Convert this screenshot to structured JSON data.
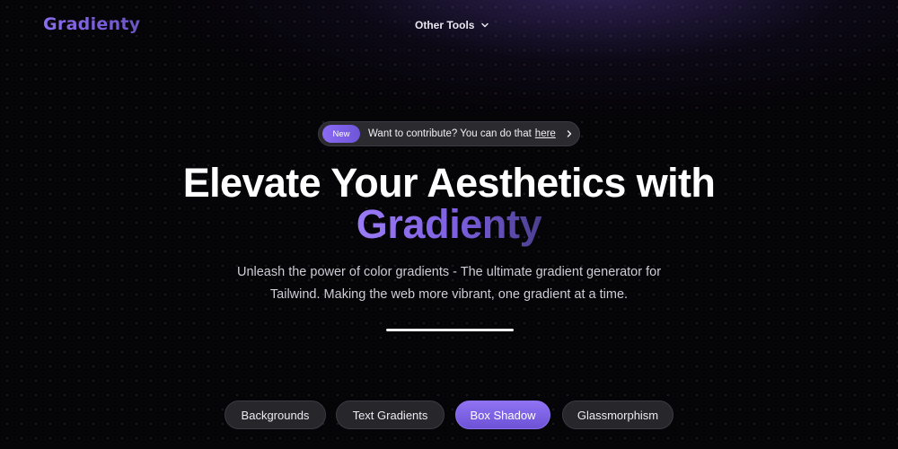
{
  "brand": {
    "logo": "Gradienty",
    "accent": "#7c5fe0"
  },
  "nav": {
    "other_tools_label": "Other Tools"
  },
  "announcement": {
    "badge": "New",
    "text": "Want to contribute? You can do that",
    "link": "here"
  },
  "hero": {
    "title_line1": "Elevate Your Aesthetics with",
    "title_highlight": "Gradienty",
    "subtitle_line1": "Unleash the power of color gradients - The ultimate gradient generator for",
    "subtitle_line2": "Tailwind. Making the web more vibrant, one gradient at a time."
  },
  "tabs": [
    {
      "label": "Backgrounds",
      "active": false
    },
    {
      "label": "Text Gradients",
      "active": false
    },
    {
      "label": "Box Shadow",
      "active": true
    },
    {
      "label": "Glassmorphism",
      "active": false
    }
  ]
}
